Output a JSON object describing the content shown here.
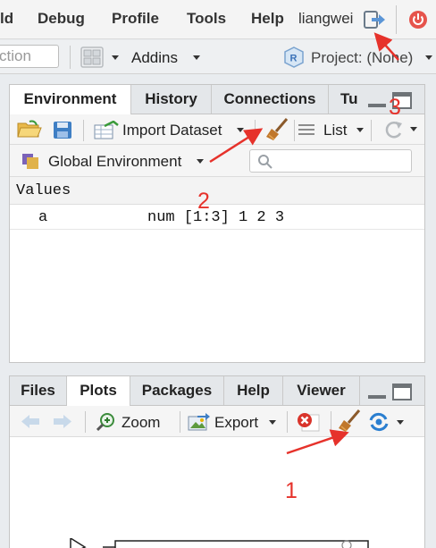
{
  "menubar": {
    "items": [
      "ld",
      "Debug",
      "Profile",
      "Tools",
      "Help"
    ],
    "user": "liangwei"
  },
  "toolbar": {
    "goto_placeholder": "ction",
    "addins_label": "Addins",
    "project_label": "Project: (None)"
  },
  "env_pane": {
    "tabs": [
      "Environment",
      "History",
      "Connections",
      "Tu"
    ],
    "import_label": "Import Dataset",
    "list_label": "List",
    "env_selector": "Global Environment",
    "section_header": "Values",
    "rows": [
      {
        "name": "a",
        "value": "num [1:3] 1 2 3"
      }
    ]
  },
  "files_pane": {
    "tabs": [
      "Files",
      "Plots",
      "Packages",
      "Help",
      "Viewer"
    ],
    "zoom_label": "Zoom",
    "export_label": "Export"
  },
  "annotations": {
    "marker_1": "1",
    "marker_2": "2",
    "marker_3": "3",
    "color": "#e6322b"
  },
  "colors": {
    "broom": "#c0772b",
    "power": "#e6534b",
    "sync": "#2b7fd0"
  }
}
